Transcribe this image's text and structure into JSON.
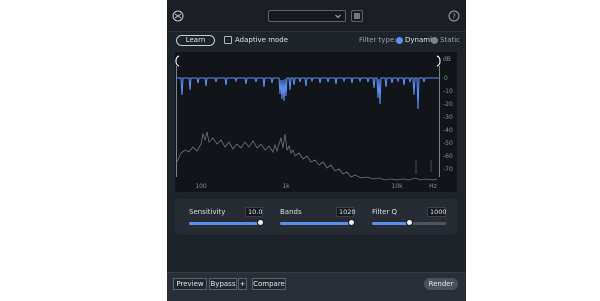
{
  "header": {
    "logo_icon": "logo-icon",
    "preset_value": "",
    "menu_icon": "hamburger-menu-icon",
    "help_icon": "help-icon"
  },
  "controls": {
    "learn_label": "Learn",
    "adaptive_label": "Adaptive mode",
    "filter_type_label": "Filter type:",
    "dynamic_label": "Dynamic",
    "static_label": "Static",
    "filter_type_selected": "Dynamic"
  },
  "graph": {
    "db_label": "dB",
    "db_ticks": [
      "0",
      "-10",
      "-20",
      "-30",
      "-40",
      "-50",
      "-60",
      "-70"
    ],
    "freq_ticks": [
      "100",
      "1k",
      "10k"
    ],
    "hz_label": "Hz"
  },
  "params": {
    "sensitivity_label": "Sensitivity",
    "sensitivity_value": "10.0",
    "sensitivity_level": 0.97,
    "bands_label": "Bands",
    "bands_value": "1020",
    "bands_level": 0.97,
    "filterq_label": "Filter Q",
    "filterq_value": "1000",
    "filterq_level": 0.5
  },
  "footer": {
    "preview_label": "Preview",
    "bypass_label": "Bypass",
    "bypass_plus": "+",
    "compare_label": "Compare",
    "render_label": "Render"
  },
  "colors": {
    "accent": "#5b8ef0",
    "background": "#1f232a"
  }
}
